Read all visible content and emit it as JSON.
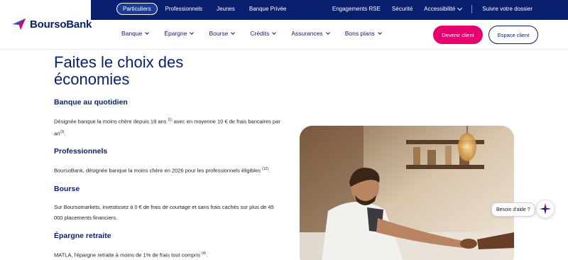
{
  "brand": {
    "name": "BoursoBank",
    "primary": "#0a1e6e",
    "accent": "#e6006f"
  },
  "topnav": {
    "items": [
      "Particuliers",
      "Professionnels",
      "Jeunes",
      "Banque Privée"
    ],
    "active": "Particuliers"
  },
  "topright": {
    "engagements": "Engagements RSE",
    "securite": "Sécurité",
    "accessibilite": "Accessibilité",
    "suivre": "Suivre votre dossier"
  },
  "mainnav": {
    "items": [
      "Banque",
      "Épargne",
      "Bourse",
      "Crédits",
      "Assurances",
      "Bons plans"
    ]
  },
  "buttons": {
    "devenir": "Devenir client",
    "espace": "Espace client"
  },
  "content": {
    "title_line1": "Faites le choix des",
    "title_line2": "économies",
    "sections": [
      {
        "heading": "Banque au quotidien",
        "text_a": "Désignée banque la moins chère depuis 18 ans ",
        "sup_a": "(1)",
        "text_b": " avec en moyenne 10 € de frais bancaires par an",
        "sup_b": "(3)",
        "text_c": "."
      },
      {
        "heading": "Professionnels",
        "text_a": "BoursoBank, désignée banque la moins chère en 2026 pour les professionnels éligibles ",
        "sup_a": "(12)",
        "text_b": "."
      },
      {
        "heading": "Bourse",
        "text_a": "Sur Boursomarkets, investissez à 0 € de frais de courtage et sans frais cachés sur plus de 45 000 placements financiers."
      },
      {
        "heading": "Épargne retraite",
        "text_a": "MATLA, l'épargne retraite à moins de 1% de frais tout compris ",
        "sup_a": "(4)",
        "text_b": "."
      }
    ]
  },
  "help": {
    "label": "Besoin d'aide ?"
  },
  "icons": {
    "logo": "boursobank-star-icon",
    "help": "assistant-star-icon"
  }
}
